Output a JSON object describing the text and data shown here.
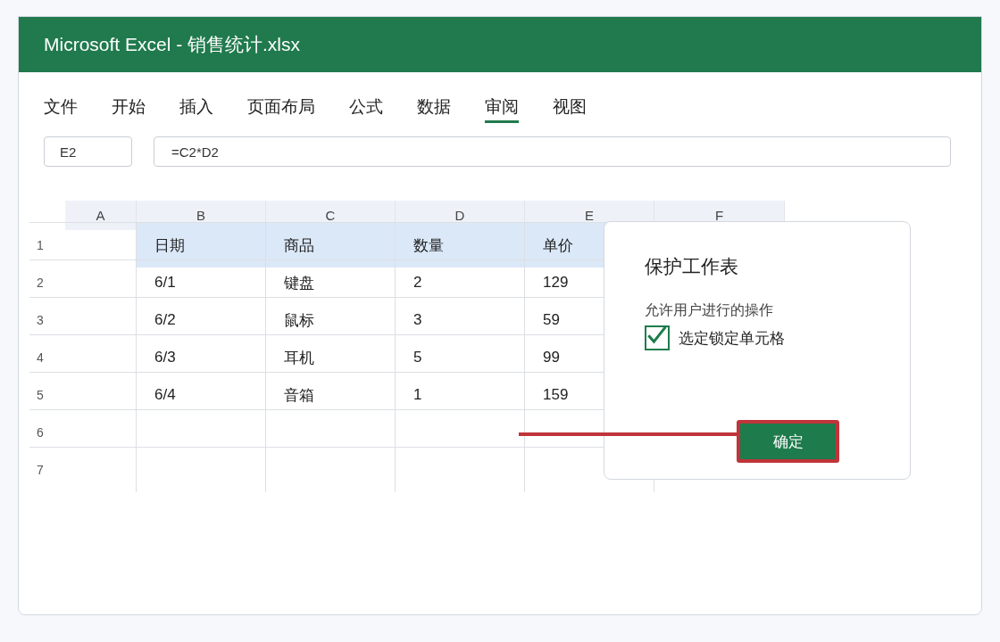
{
  "window": {
    "title": "Microsoft Excel - 销售统计.xlsx"
  },
  "tabs": [
    {
      "label": "文件",
      "selected": false
    },
    {
      "label": "开始",
      "selected": false
    },
    {
      "label": "插入",
      "selected": false
    },
    {
      "label": "页面布局",
      "selected": false
    },
    {
      "label": "公式",
      "selected": false
    },
    {
      "label": "数据",
      "selected": false
    },
    {
      "label": "审阅",
      "selected": true
    },
    {
      "label": "视图",
      "selected": false
    }
  ],
  "name_box": {
    "value": "E2"
  },
  "formula_bar": {
    "value": "=C2*D2"
  },
  "sheet": {
    "columns": [
      "A",
      "B",
      "C",
      "D",
      "E",
      "F"
    ],
    "rows": [
      {
        "number": "1",
        "kind": "header",
        "values": [
          "日期",
          "商品",
          "数量",
          "单价"
        ]
      },
      {
        "number": "2",
        "kind": "data",
        "values": [
          "6/1",
          "键盘",
          "2",
          "129"
        ]
      },
      {
        "number": "3",
        "kind": "data",
        "values": [
          "6/2",
          "鼠标",
          "3",
          "59"
        ]
      },
      {
        "number": "4",
        "kind": "data",
        "values": [
          "6/3",
          "耳机",
          "5",
          "99"
        ]
      },
      {
        "number": "5",
        "kind": "data",
        "values": [
          "6/4",
          "音箱",
          "1",
          "159"
        ]
      },
      {
        "number": "6",
        "kind": "data"
      },
      {
        "number": "7",
        "kind": "data"
      }
    ]
  },
  "dialog": {
    "title": "保护工作表",
    "subtitle": "允许用户进行的操作",
    "options": [
      {
        "label": "选定锁定单元格",
        "checked": true
      }
    ],
    "confirm_button": {
      "label": "确定",
      "highlighted": true
    }
  }
}
